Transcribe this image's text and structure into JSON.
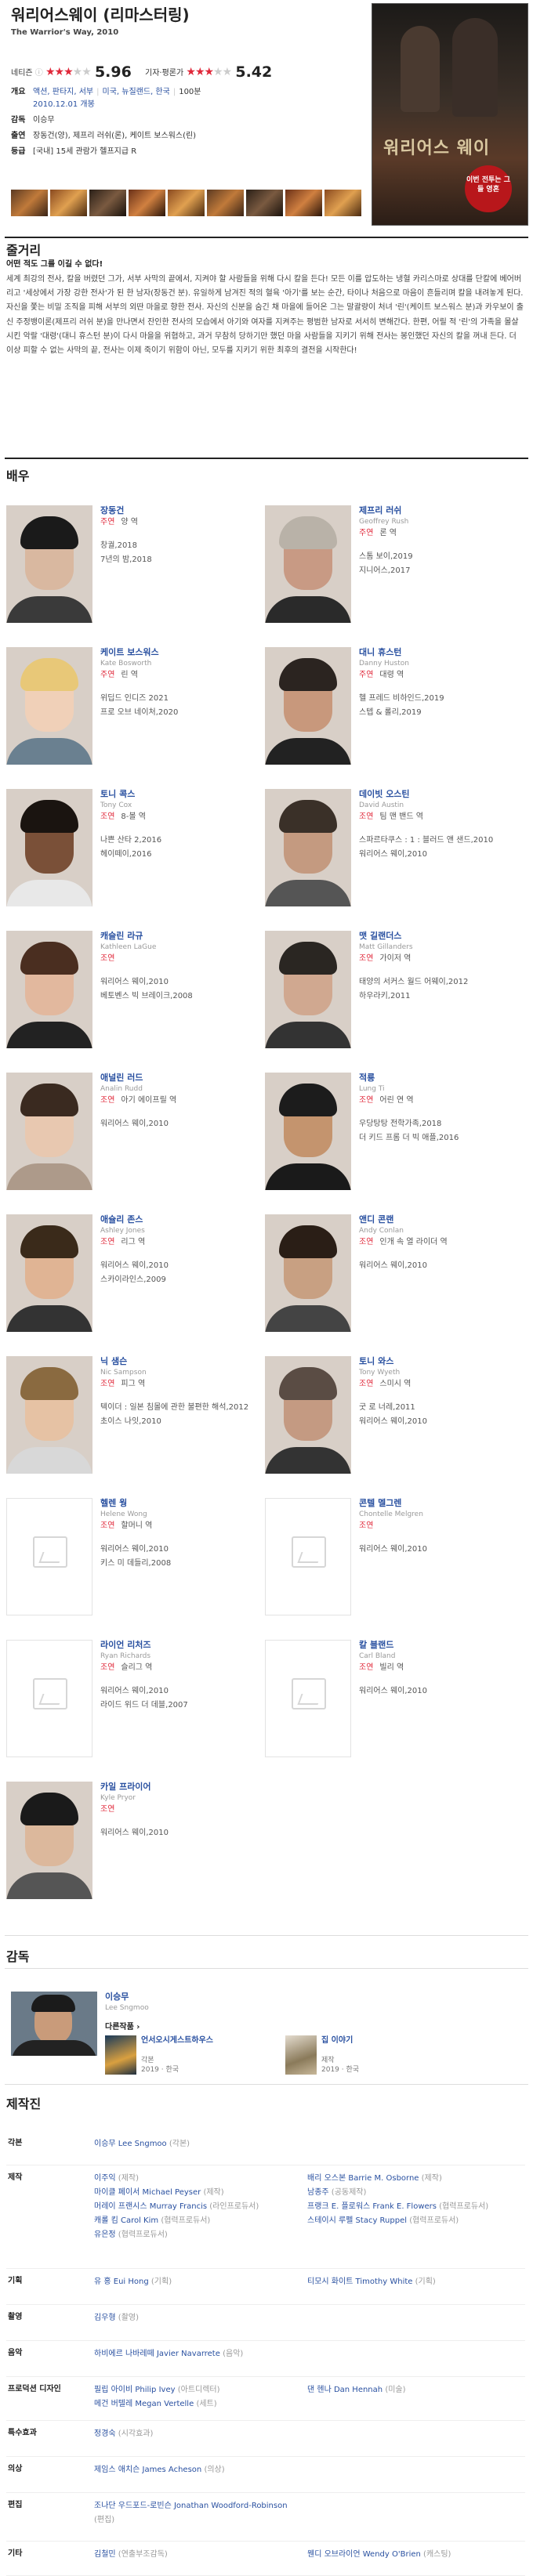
{
  "movie": {
    "title": "워리어스웨이 (리마스터링)",
    "subtitle": "The Warrior's Way, 2010",
    "netizen_label": "네티즌",
    "netizen_score": "5.96",
    "critic_label": "기자·평론가",
    "critic_score": "5.42",
    "poster_text": "워리어스 웨이",
    "poster_badge": "이번 전투는 그들 영혼",
    "info": [
      {
        "key": "개요",
        "genre": "액션, 판타지, 서부",
        "country": "미국, 뉴질랜드, 한국",
        "runtime": "100분",
        "release": "2010.12.01 개봉"
      },
      {
        "key": "감독",
        "value": "이승무"
      },
      {
        "key": "출연",
        "value": "장동건(양), 제프리 러쉬(론), 케이트 보스워스(린)"
      },
      {
        "key": "등급",
        "value": "[국내] 15세 관람가 헬프지급 R"
      }
    ]
  },
  "sections": {
    "synopsis": "줄거리",
    "cast": "배우",
    "director": "감독",
    "crew": "제작진"
  },
  "synopsis": {
    "headline": "어떤 적도 그를 이길 수 없다!",
    "body": "세계 최강의 전사, 칼을 버렸던 그가, 서부 사막의 끝에서, 지켜야 할 사람들을 위해 다시 칼을 든다! 모든 이를 압도하는 냉혈 카리스마로 상대를 단칼에 베어버리고 '세상에서 가장 강한 전사'가 된 한 남자(장동건 분). 유일하게 남겨진 적의 혈육 '아기'를 보는 순간, 타이나 처음으로 마음이 흔들리며 칼을 내려놓게 된다. 자신을 쫓는 비밀 조직을 피해 서부의 외딴 마을로 향한 전사. 자신의 신분을 숨긴 채 마을에 들어온 그는 말괄량이 처녀 '린'(케이트 보스워스 분)과 카우보이 출신 주정뱅이론(제프리 러쉬 분)을 만나면서 잔인한 전사의 모습에서 아기와 여자를 지켜주는 평범한 남자로 서서히 변해간다. 한편, 어릴 적 '린'의 가족을 몰살시킨 악랄 '대령'(대니 휴스턴 분)이 다시 마을을 위협하고, 과거 무참히 당하기만 했던 마을 사람들을 지키기 위해 전사는 봉인했던 자신의 칼을 꺼내 든다. 더 이상 피할 수 없는 사막의 끝, 전사는 이제 죽이기 위함이 아닌, 모두를 지키기 위한 최후의 결전을 시작한다!"
  },
  "cast": [
    {
      "name": "장동건",
      "name_en": "",
      "kind": "주연",
      "role": "양 역",
      "works": [
        "창궐,2018",
        "7년의 밤,2018"
      ],
      "photo": "actor-photo"
    },
    {
      "name": "제프리 러쉬",
      "name_en": "Geoffrey Rush",
      "kind": "주연",
      "role": "론 역",
      "works": [
        "스톰 보이,2019",
        "지니어스,2017"
      ],
      "photo": "actor-photo"
    },
    {
      "name": "케이트 보스워스",
      "name_en": "Kate Bosworth",
      "kind": "주연",
      "role": "린 역",
      "works": [
        "위딥드 인디즈 2021",
        "프로 오브 네이처,2020"
      ],
      "photo": "actor-photo"
    },
    {
      "name": "대니 휴스턴",
      "name_en": "Danny Huston",
      "kind": "주연",
      "role": "대령 역",
      "works": [
        "헬 프레드 비하인드,2019",
        "스텝 & 롤리,2019"
      ],
      "photo": "actor-photo"
    },
    {
      "name": "토니 콕스",
      "name_en": "Tony Cox",
      "kind": "조연",
      "role": "8-볼 역",
      "works": [
        "나쁜 산타 2,2016",
        "헤이떼이,2016"
      ],
      "photo": "actor-photo"
    },
    {
      "name": "데이빗 오스틴",
      "name_en": "David Austin",
      "kind": "조연",
      "role": "팀 맨 밴드 역",
      "works": [
        "스파르타쿠스 : 1 : 블러드 앤 샌드,2010",
        "워리어스 웨이,2010"
      ],
      "photo": "actor-photo"
    },
    {
      "name": "캐슬린 라규",
      "name_en": "Kathleen LaGue",
      "kind": "조연",
      "role": "",
      "works": [
        "워리어스 웨이,2010",
        "베토벤스 빅 브레이크,2008"
      ],
      "photo": "actor-photo"
    },
    {
      "name": "맷 길랜더스",
      "name_en": "Matt Gillanders",
      "kind": "조연",
      "role": "가이저 역",
      "works": [
        "태양의 서커스 월드 어웨이,2012",
        "하우라키,2011"
      ],
      "photo": "actor-photo"
    },
    {
      "name": "애널린 러드",
      "name_en": "Analin Rudd",
      "kind": "조연",
      "role": "아기 에이프릴 역",
      "works": [
        "워리어스 웨이,2010"
      ],
      "photo": "actor-photo"
    },
    {
      "name": "적룡",
      "name_en": "Lung Ti",
      "kind": "조연",
      "role": "어린 연 역",
      "works": [
        "우당탕탕 전학가족,2018",
        "더 키드 프롬 더 빅 애플,2016"
      ],
      "photo": "actor-photo"
    },
    {
      "name": "애슐리 존스",
      "name_en": "Ashley Jones",
      "kind": "조연",
      "role": "리그 역",
      "works": [
        "워리어스 웨이,2010",
        "스카이라인스,2009"
      ],
      "photo": "actor-photo"
    },
    {
      "name": "앤디 콘랜",
      "name_en": "Andy Conlan",
      "kind": "조연",
      "role": "인개 속 열 라이더 역",
      "works": [
        "워리어스 웨이,2010"
      ],
      "photo": "actor-photo"
    },
    {
      "name": "닉 샘슨",
      "name_en": "Nic Sampson",
      "kind": "조연",
      "role": "피그 역",
      "works": [
        "텍이더 : 일본 침몰에 관한 불편한 해석,2012",
        "초이스 나잇,2010"
      ],
      "photo": "actor-photo"
    },
    {
      "name": "토니 와스",
      "name_en": "Tony Wyeth",
      "kind": "조연",
      "role": "스미시 역",
      "works": [
        "굿 로 너레,2011",
        "워리어스 웨이,2010"
      ],
      "photo": "actor-photo"
    },
    {
      "name": "헬렌 웡",
      "name_en": "Helene Wong",
      "kind": "조연",
      "role": "할머니 역",
      "works": [
        "워리어스 웨이,2010",
        "키스 미 데들리,2008"
      ],
      "photo": "empty"
    },
    {
      "name": "콘텔 멜그렌",
      "name_en": "Chontelle Melgren",
      "kind": "조연",
      "role": "",
      "works": [
        "워리어스 웨이,2010"
      ],
      "photo": "empty"
    },
    {
      "name": "라이언 리처즈",
      "name_en": "Ryan Richards",
      "kind": "조연",
      "role": "슬리그 역",
      "works": [
        "워리어스 웨이,2010",
        "라이드 위드 더 데블,2007"
      ],
      "photo": "empty"
    },
    {
      "name": "칼 블랜드",
      "name_en": "Carl Bland",
      "kind": "조연",
      "role": "빌리 역",
      "works": [
        "워리어스 웨이,2010"
      ],
      "photo": "empty"
    },
    {
      "name": "카일 프라이어",
      "name_en": "Kyle Pryor",
      "kind": "조연",
      "role": "",
      "works": [
        "워리어스 웨이,2010"
      ],
      "photo": "actor-photo"
    }
  ],
  "director": {
    "name": "이승무",
    "name_en": "Lee Sngmoo",
    "other_label": "다른작품 ›",
    "works": [
      {
        "title": "언서오시게스트하우스",
        "role": "각본",
        "meta": "2019 · 한국"
      },
      {
        "title": "집 이야기",
        "role": "제작",
        "meta": "2019 · 한국"
      }
    ]
  },
  "crew": [
    {
      "key": "각본",
      "left": [
        [
          "이승무 Lee Sngmoo",
          "(각본)"
        ]
      ],
      "right": []
    },
    {
      "key": "제작",
      "left": [
        [
          "이주익",
          "(제작)"
        ],
        [
          "마이클 페이서 Michael Peyser",
          "(제작)"
        ],
        [
          "머레이 프랜시스 Murray Francis",
          "(라인프로듀서)"
        ],
        [
          "캐롤 킴 Carol Kim",
          "(협력프로듀서)"
        ],
        [
          "유은정",
          "(협력프로듀서)"
        ]
      ],
      "right": [
        [
          "배리 오스본 Barrie M. Osborne",
          "(제작)"
        ],
        [
          "남종주",
          "(공동제작)"
        ],
        [
          "프랭크 E. 플로워스 Frank E. Flowers",
          "(협력프로듀서)"
        ],
        [
          "스테이시 루펠 Stacy Ruppel",
          "(협력프로듀서)"
        ]
      ]
    },
    {
      "key": "기획",
      "left": [
        [
          "유 홍 Eui Hong",
          "(기획)"
        ]
      ],
      "right": [
        [
          "티모시 화이트 Timothy White",
          "(기획)"
        ]
      ]
    },
    {
      "key": "촬영",
      "left": [
        [
          "김우형",
          "(촬영)"
        ]
      ],
      "right": []
    },
    {
      "key": "음악",
      "left": [
        [
          "하비에르 나바레떼 Javier Navarrete",
          "(음악)"
        ]
      ],
      "right": []
    },
    {
      "key": "프로덕션 디자인",
      "left": [
        [
          "필립 아이비 Philip Ivey",
          "(아트디렉터)"
        ],
        [
          "메건 버텔레 Megan Vertelle",
          "(세트)"
        ]
      ],
      "right": [
        [
          "댄 헨나 Dan Hennah",
          "(미술)"
        ]
      ]
    },
    {
      "key": "특수효과",
      "left": [
        [
          "정경숙",
          "(시각효과)"
        ]
      ],
      "right": []
    },
    {
      "key": "의상",
      "left": [
        [
          "제임스 애치슨 James Acheson",
          "(의상)"
        ]
      ],
      "right": []
    },
    {
      "key": "편집",
      "left": [
        [
          "조나단 우드포드-로빈슨 Jonathan Woodford-Robinson",
          "(편집)"
        ]
      ],
      "right": []
    },
    {
      "key": "기타",
      "left": [
        [
          "김철민",
          "(연출부조감독)"
        ]
      ],
      "right": [
        [
          "웬디 오브라이언 Wendy O'Brien",
          "(캐스팅)"
        ]
      ]
    }
  ],
  "colors": {
    "accent": "#e0283a",
    "link": "#2950a0",
    "star": "#e0283a"
  }
}
